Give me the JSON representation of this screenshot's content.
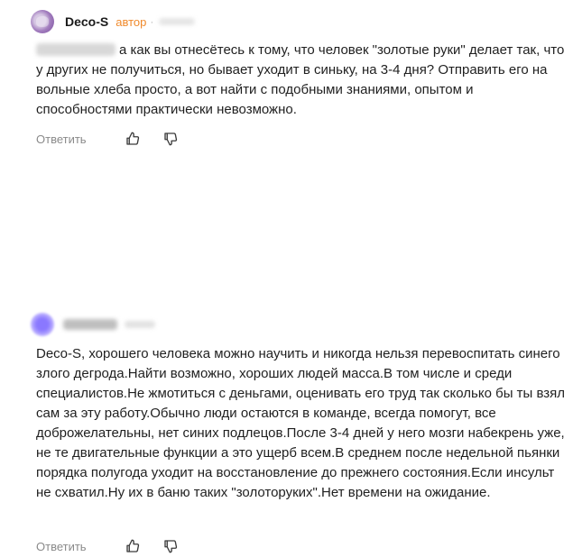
{
  "comments": [
    {
      "author": "Deco-S",
      "badge": "автор",
      "text": "а как вы отнесётесь к тому, что человек \"золотые руки\" делает так, что у других не получиться, но бывает уходит в синьку, на 3-4 дня? Отправить его на вольные хлеба просто, а вот найти с подобными знаниями, опытом и способностями практически невозможно.",
      "reply_label": "Ответить"
    },
    {
      "text": "Deco-S, хорошего человека можно научить и никогда нельзя перевоспитать синего злого дегрода.Найти возможно, хороших людей масса.В том числе и среди специалистов.Не жмотиться с деньгами, оценивать его труд так сколько бы ты взял сам за эту работу.Обычно люди остаются в команде, всегда помогут, все доброжелательны, нет синих подлецов.После 3-4 дней у него мозги набекрень уже, не те двигательные функции а это ущерб всем.В среднем после недельной пьянки порядка полугода уходит на восстановление до прежнего состояния.Если инсульт не схватил.Ну их в баню таких \"золоторуких\".Нет времени на ожидание.",
      "reply_label": "Ответить"
    }
  ],
  "colors": {
    "badge": "#f08a2c",
    "muted": "#8a8a8a",
    "text": "#1f1f1f"
  },
  "icons": [
    "thumbs-up-icon",
    "thumbs-down-icon"
  ]
}
